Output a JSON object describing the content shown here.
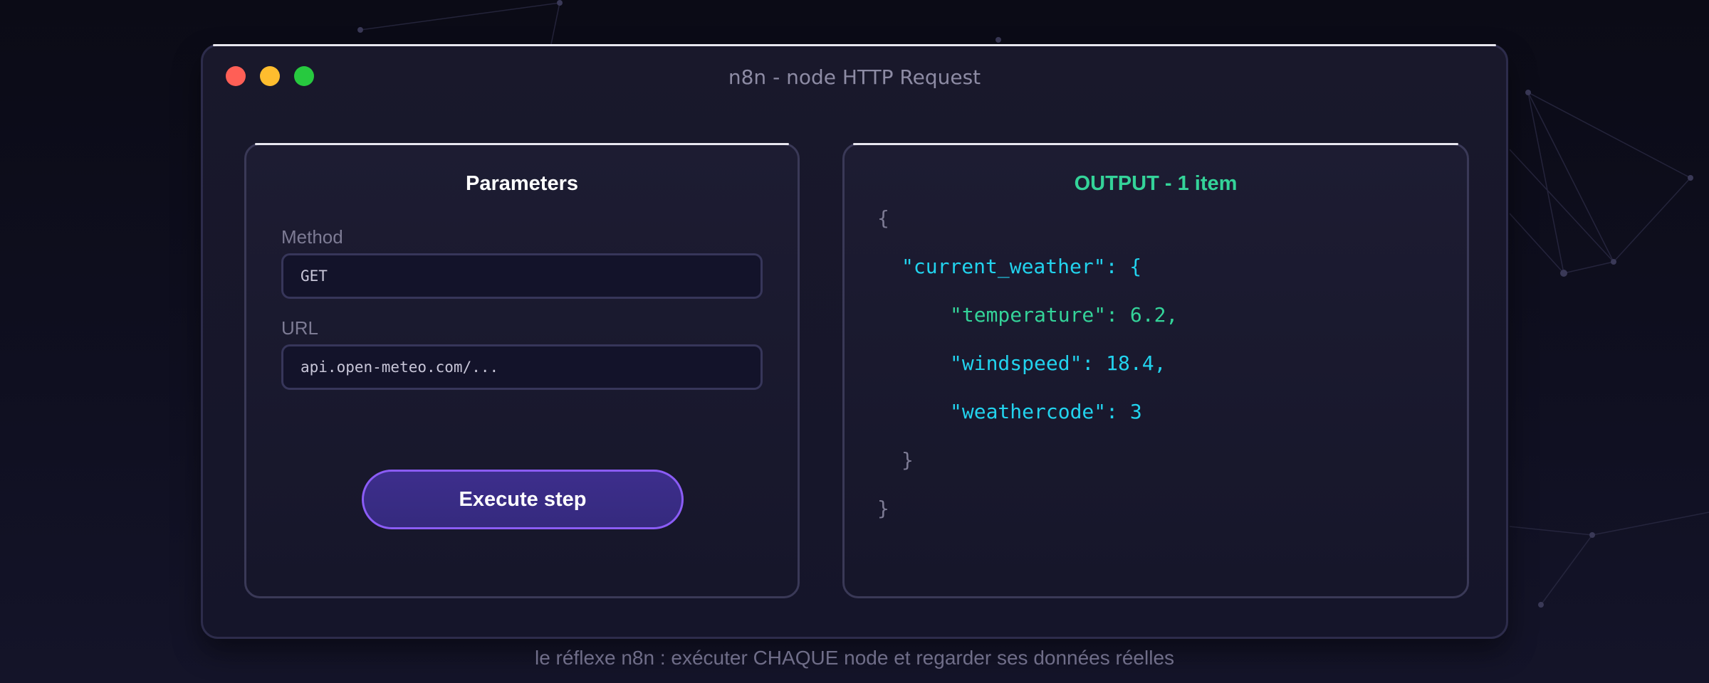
{
  "window": {
    "title": "n8n - node HTTP Request"
  },
  "parameters": {
    "title": "Parameters",
    "method_label": "Method",
    "method_value": "GET",
    "url_label": "URL",
    "url_value": "api.open-meteo.com/...",
    "execute_label": "Execute step"
  },
  "output": {
    "title": "OUTPUT - 1 item",
    "lines": [
      "{",
      "\"current_weather\": {",
      "\"temperature\": 6.2,",
      "\"windspeed\": 18.4,",
      "\"weathercode\": 3",
      "}",
      "}"
    ]
  },
  "caption": "le réflexe n8n : exécuter CHAQUE node et regarder ses données réelles",
  "colors": {
    "accent_purple": "#8b5cf6",
    "output_green": "#34d399",
    "json_cyan": "#22d3ee",
    "traffic_red": "#ff5f56",
    "traffic_yellow": "#ffbd2e",
    "traffic_green": "#27c93f"
  }
}
